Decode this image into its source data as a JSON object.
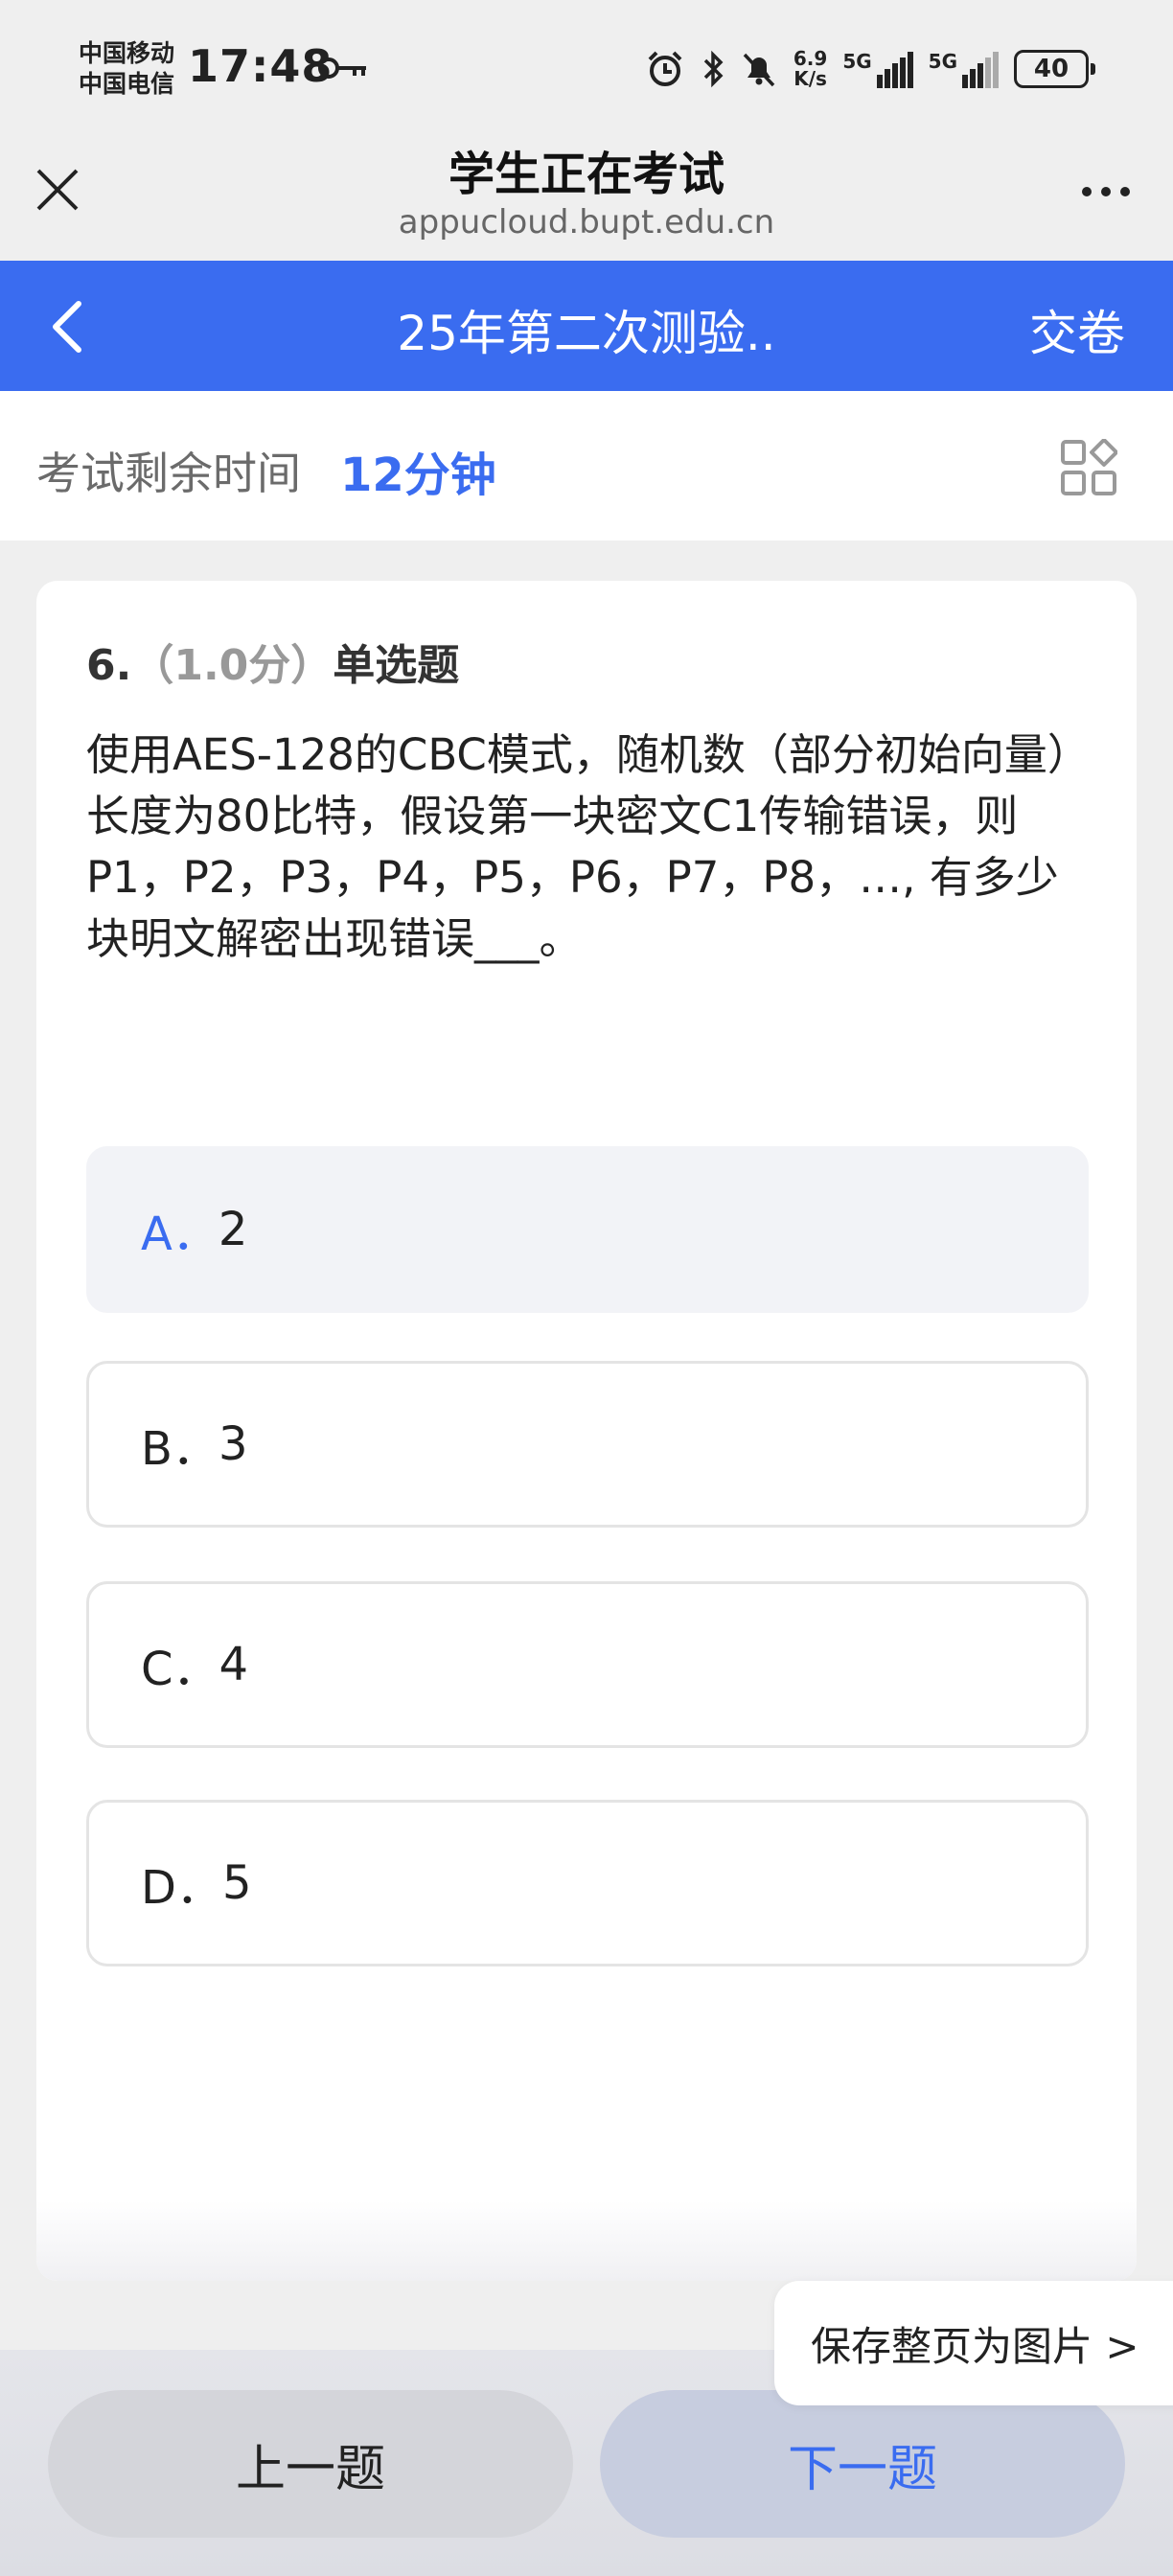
{
  "status_bar": {
    "carrier_1": "中国移动",
    "carrier_2": "中国电信",
    "time": "17:48",
    "net_speed_value": "6.9",
    "net_speed_unit": "K/s",
    "sim1_label": "5G",
    "sim2_label": "5G",
    "battery": "40"
  },
  "browser": {
    "title": "学生正在考试",
    "url": "appucloud.bupt.edu.cn"
  },
  "nav": {
    "title": "25年第二次测验..",
    "submit_label": "交卷"
  },
  "timer": {
    "label": "考试剩余时间",
    "value": "12分钟"
  },
  "question": {
    "number": "6.",
    "score": "（1.0分）",
    "type": "单选题",
    "text": "使用AES-128的CBC模式，随机数（部分初始向量）长度为80比特，假设第一块密文C1传输错误，则P1，P2，P3，P4，P5，P6，P7，P8，…, 有多少块明文解密出现错误___。",
    "options": [
      {
        "letter": "A．",
        "value": "2"
      },
      {
        "letter": "B．",
        "value": "3"
      },
      {
        "letter": "C．",
        "value": "4"
      },
      {
        "letter": "D．",
        "value": "5"
      }
    ],
    "selected_option": "A"
  },
  "actions": {
    "save_page_label": "保存整页为图片 >",
    "prev_label": "上一题",
    "next_label": "下一题"
  },
  "colors": {
    "accent": "#3a6cf0",
    "background": "#efefef"
  }
}
